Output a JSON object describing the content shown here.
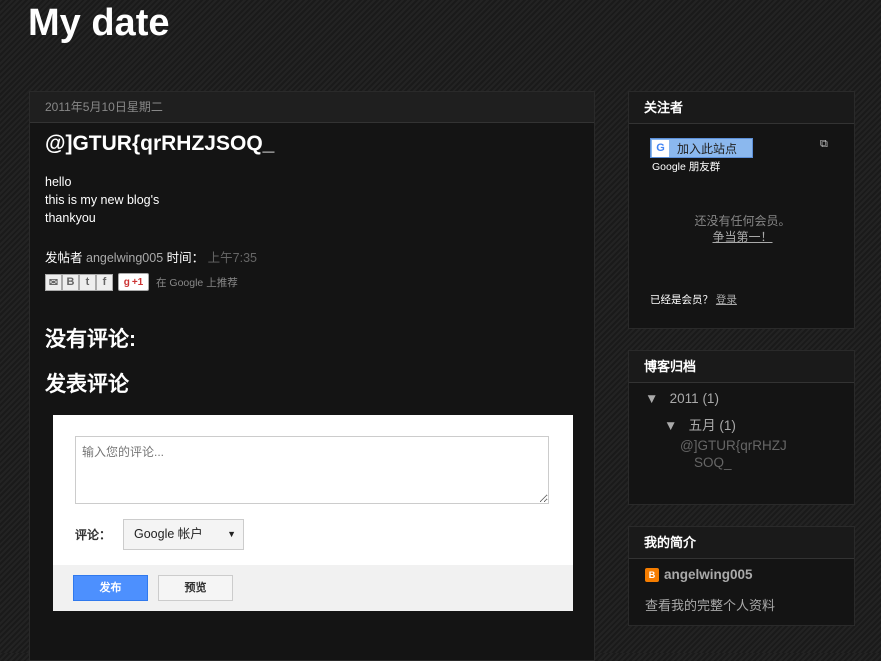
{
  "blog": {
    "title": "My date"
  },
  "post": {
    "date": "2011年5月10日星期二",
    "title": "@]GTUR{qrRHZJSOQ_",
    "body_lines": [
      "hello",
      "this is my new blog's",
      "thankyou"
    ],
    "posted_by_label": "发帖者",
    "author": "angelwing005",
    "time_label": "时间：",
    "time": "上午7:35",
    "share_icons": [
      "email-icon",
      "blogthis-icon",
      "twitter-icon",
      "facebook-icon"
    ],
    "plusone_label": "+1",
    "recommend_text": "在 Google 上推荐"
  },
  "comments": {
    "no_comments": "没有评论:",
    "post_comment_heading": "发表评论",
    "textarea_placeholder": "输入您的评论...",
    "comment_as_label": "评论：",
    "account_selected": "Google 帐户",
    "publish_label": "发布",
    "preview_label": "预览"
  },
  "followers": {
    "title": "关注者",
    "join_label": "加入此站点",
    "gfc_label": "Google 朋友群",
    "no_members": "还没有任何会员。",
    "be_first": "争当第一！",
    "already_member": "已经是会员？",
    "login": "登录"
  },
  "archive": {
    "title": "博客归档",
    "year": "2011",
    "year_count": "(1)",
    "month": "五月",
    "month_count": "(1)",
    "post_line1": "@]GTUR{qrRHZJ",
    "post_line2": "SOQ_",
    "arrow": "▼"
  },
  "profile": {
    "title": "我的简介",
    "name": "angelwing005",
    "view_profile": "查看我的完整个人资料"
  }
}
